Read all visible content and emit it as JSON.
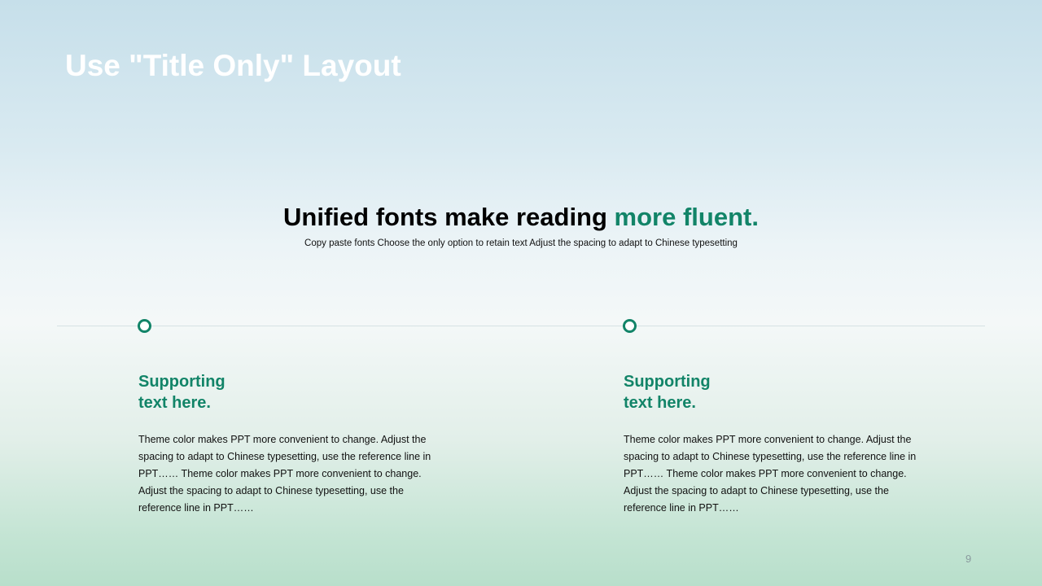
{
  "slide": {
    "title": "Use \"Title Only\" Layout",
    "headline": {
      "main": "Unified fonts make reading ",
      "accent": "more fluent."
    },
    "subline": "Copy paste fonts Choose the only option to retain text Adjust the spacing to adapt to Chinese typesetting",
    "columns": [
      {
        "heading_line1": "Supporting",
        "heading_line2": "text here.",
        "body": "Theme color makes PPT more convenient to change. Adjust the spacing to adapt to Chinese typesetting, use the reference line in PPT…… Theme color makes PPT more convenient to change. Adjust the spacing to adapt to Chinese typesetting, use the reference line in PPT……"
      },
      {
        "heading_line1": "Supporting",
        "heading_line2": "text here.",
        "body": "Theme color makes PPT more convenient to change. Adjust the spacing to adapt to Chinese typesetting, use the reference line in PPT…… Theme color makes PPT more convenient to change. Adjust the spacing to adapt to Chinese typesetting, use the reference line in PPT……"
      }
    ],
    "page_number": "9"
  },
  "colors": {
    "accent": "#128468",
    "title_text": "#ffffff",
    "body_text": "#111111",
    "page_number": "#8a9a9e"
  }
}
